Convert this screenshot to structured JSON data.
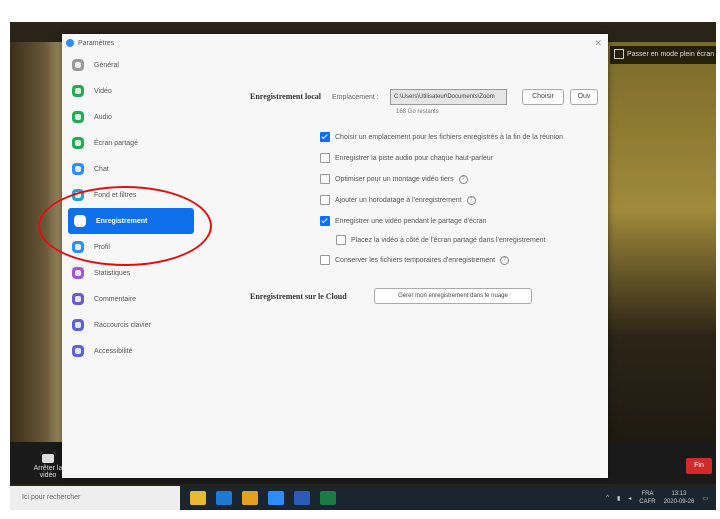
{
  "window": {
    "title": "Paramètres"
  },
  "zoom_bar": {
    "label": "Passer en mode plein écran"
  },
  "sidebar": {
    "items": [
      {
        "label": "Général",
        "icon": "gear-icon",
        "color": "#999999"
      },
      {
        "label": "Vidéo",
        "icon": "video-icon",
        "color": "#22aa55"
      },
      {
        "label": "Audio",
        "icon": "headphones-icon",
        "color": "#22aa55"
      },
      {
        "label": "Écran partagé",
        "icon": "share-screen-icon",
        "color": "#22aa55"
      },
      {
        "label": "Chat",
        "icon": "chat-icon",
        "color": "#2d8cff"
      },
      {
        "label": "Fond et filtres",
        "icon": "background-icon",
        "color": "#26a0da"
      },
      {
        "label": "Enregistrement",
        "icon": "record-icon",
        "color": "#ffffff",
        "active": true
      },
      {
        "label": "Profil",
        "icon": "profile-icon",
        "color": "#2d8cff"
      },
      {
        "label": "Statistiques",
        "icon": "statistics-icon",
        "color": "#9b59d0"
      },
      {
        "label": "Commentaire",
        "icon": "feedback-icon",
        "color": "#6a5acd"
      },
      {
        "label": "Raccourcis clavier",
        "icon": "keyboard-icon",
        "color": "#5b63d6"
      },
      {
        "label": "Accessibilité",
        "icon": "accessibility-icon",
        "color": "#5b63d6"
      }
    ]
  },
  "local_recording": {
    "section_label": "Enregistrement local",
    "location_label": "Emplacement :",
    "path": "C:\\Users\\Utilisateur\\Documents\\Zoom",
    "choose_button": "Choisir",
    "open_button": "Ouv",
    "remaining": "168 Go restants",
    "options": [
      {
        "label": "Choisir un emplacement pour les fichiers enregistrés à la fin de la réunion",
        "checked": true,
        "info": false
      },
      {
        "label": "Enregistrer la piste audio pour chaque haut-parleur",
        "checked": false,
        "info": false
      },
      {
        "label": "Optimiser pour un montage vidéo tiers",
        "checked": false,
        "info": true
      },
      {
        "label": "Ajouter un horodatage à l'enregistrement",
        "checked": false,
        "info": true
      },
      {
        "label": "Enregistrer une vidéo pendant le partage d'écran",
        "checked": true,
        "info": false
      },
      {
        "label": "Placez la vidéo à côté de l'écran partagé dans l'enregistrement",
        "checked": false,
        "info": false,
        "indent": true
      },
      {
        "label": "Conserver les fichiers temporaires d'enregistrement",
        "checked": false,
        "info": true
      }
    ]
  },
  "cloud_recording": {
    "section_label": "Enregistrement sur le Cloud",
    "manage_button": "Gérer mon enregistrement dans le nuage"
  },
  "meeting": {
    "mute_label": "Arrêter la vidéo",
    "end_button": "Fin"
  },
  "taskbar": {
    "search_placeholder": "Ici pour rechercher",
    "lang": "FRA",
    "locale": "CAFR",
    "time": "13:13",
    "date": "2020-09-26"
  }
}
